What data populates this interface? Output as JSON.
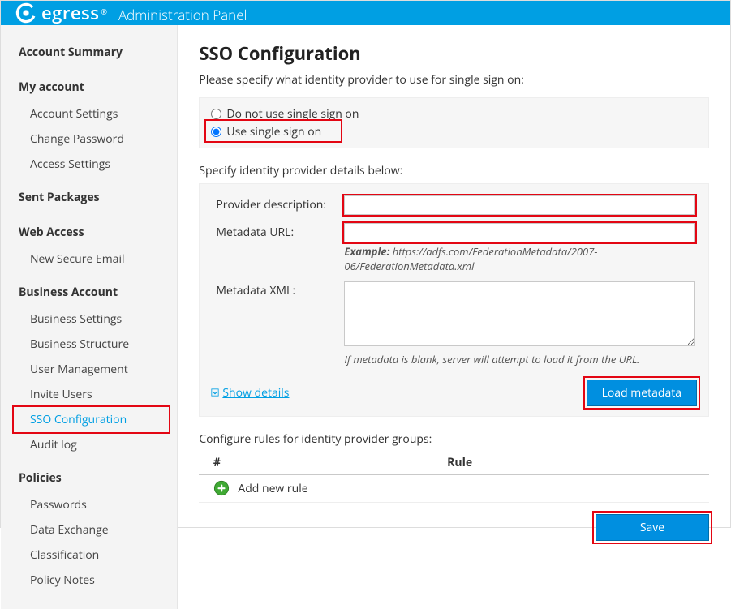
{
  "brand": {
    "name": "egress",
    "panel": "Administration Panel"
  },
  "sidebar": {
    "sections": [
      {
        "title": "Account Summary",
        "items": []
      },
      {
        "title": "My account",
        "items": [
          {
            "label": "Account Settings"
          },
          {
            "label": "Change Password"
          },
          {
            "label": "Access Settings"
          }
        ]
      },
      {
        "title": "Sent Packages",
        "items": []
      },
      {
        "title": "Web Access",
        "items": [
          {
            "label": "New Secure Email"
          }
        ]
      },
      {
        "title": "Business Account",
        "items": [
          {
            "label": "Business Settings"
          },
          {
            "label": "Business Structure"
          },
          {
            "label": "User Management"
          },
          {
            "label": "Invite Users"
          },
          {
            "label": "SSO Configuration",
            "active": true
          },
          {
            "label": "Audit log"
          }
        ]
      },
      {
        "title": "Policies",
        "items": [
          {
            "label": "Passwords"
          },
          {
            "label": "Data Exchange"
          },
          {
            "label": "Classification"
          },
          {
            "label": "Policy Notes"
          }
        ]
      }
    ]
  },
  "page": {
    "title": "SSO Configuration",
    "instruction": "Please specify what identity provider to use for single sign on:",
    "radios": {
      "off": "Do not use single sign on",
      "on": "Use single sign on",
      "selected": "on"
    },
    "details_header": "Specify identity provider details below:",
    "labels": {
      "desc": "Provider description:",
      "url": "Metadata URL:",
      "xml": "Metadata XML:"
    },
    "values": {
      "desc": "",
      "url": "",
      "xml": ""
    },
    "hints": {
      "url_example_prefix": "Example: ",
      "url_example": "https://adfs.com/FederationMetadata/2007-06/FederationMetadata.xml",
      "xml_hint": "If metadata is blank, server will attempt to load it from the URL."
    },
    "show_details": "Show details",
    "load_btn": "Load metadata",
    "rules_header": "Configure rules for identity provider groups:",
    "table": {
      "col_index": "#",
      "col_rule": "Rule",
      "add": "Add new rule"
    },
    "save_btn": "Save"
  },
  "colors": {
    "accent": "#009fe3",
    "highlight": "#e30613"
  }
}
